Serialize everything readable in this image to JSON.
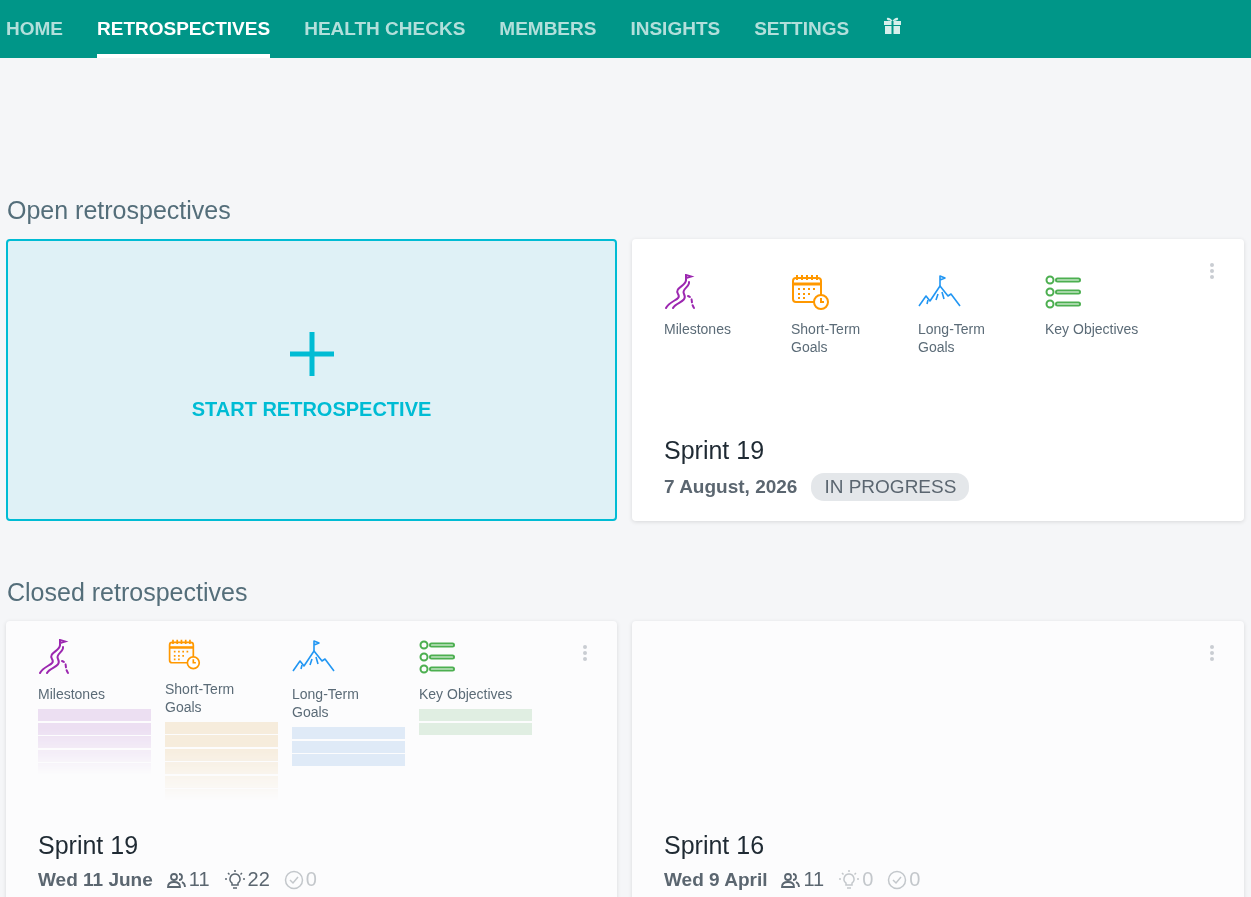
{
  "nav": {
    "tabs": [
      {
        "label": "HOME",
        "selected": false
      },
      {
        "label": "RETROSPECTIVES",
        "selected": true
      },
      {
        "label": "HEALTH CHECKS",
        "selected": false
      },
      {
        "label": "MEMBERS",
        "selected": false
      },
      {
        "label": "INSIGHTS",
        "selected": false
      },
      {
        "label": "SETTINGS",
        "selected": false
      }
    ]
  },
  "open_section": {
    "heading": "Open retrospectives",
    "start_card": {
      "label": "START RETROSPECTIVE"
    },
    "cards": [
      {
        "title": "Sprint 19",
        "date": "7 August, 2026",
        "status": "IN PROGRESS",
        "preview": false,
        "columns": [
          {
            "kind": "milestones",
            "label": "Milestones"
          },
          {
            "kind": "short_term",
            "label": "Short-Term Goals"
          },
          {
            "kind": "long_term",
            "label": "Long-Term Goals"
          },
          {
            "kind": "objectives",
            "label": "Key Objectives"
          }
        ]
      }
    ]
  },
  "closed_section": {
    "heading": "Closed retrospectives",
    "cards": [
      {
        "title": "Sprint 19",
        "date": "Wed 11 June",
        "preview": true,
        "columns": [
          {
            "kind": "milestones",
            "label": "Milestones"
          },
          {
            "kind": "short_term",
            "label": "Short-Term Goals"
          },
          {
            "kind": "long_term",
            "label": "Long-Term Goals"
          },
          {
            "kind": "objectives",
            "label": "Key Objectives"
          }
        ],
        "stats": [
          {
            "kind": "participants",
            "value": "11",
            "muted": false
          },
          {
            "kind": "ideas",
            "value": "22",
            "muted": false
          },
          {
            "kind": "actions",
            "value": "0",
            "muted": true
          }
        ]
      },
      {
        "title": "Sprint 16",
        "date": "Wed 9 April",
        "preview": false,
        "stats": [
          {
            "kind": "participants",
            "value": "11",
            "muted": false
          },
          {
            "kind": "ideas",
            "value": "0",
            "muted": true
          },
          {
            "kind": "actions",
            "value": "0",
            "muted": true
          }
        ]
      }
    ]
  }
}
